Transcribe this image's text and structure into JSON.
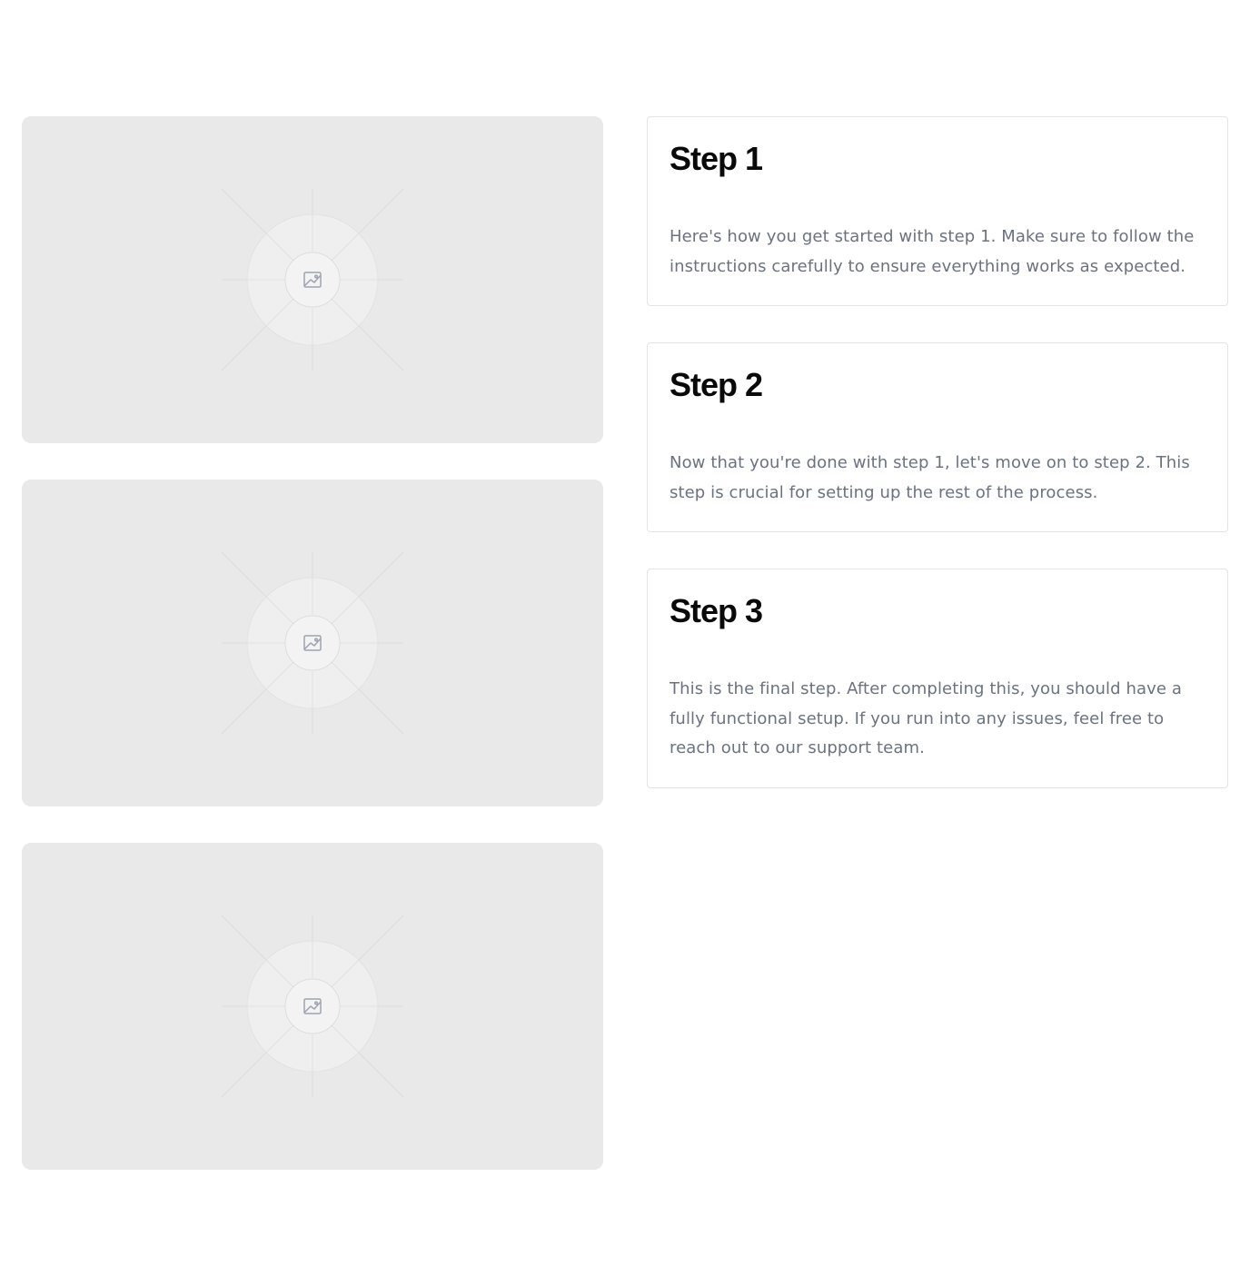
{
  "images": [
    {
      "icon": "image-icon"
    },
    {
      "icon": "image-icon"
    },
    {
      "icon": "image-icon"
    }
  ],
  "steps": [
    {
      "title": "Step 1",
      "description": "Here's how you get started with step 1. Make sure to follow the instructions carefully to ensure everything works as expected."
    },
    {
      "title": "Step 2",
      "description": "Now that you're done with step 1, let's move on to step 2. This step is crucial for setting up the rest of the process."
    },
    {
      "title": "Step 3",
      "description": "This is the final step. After completing this, you should have a fully functional setup. If you run into any issues, feel free to reach out to our support team."
    }
  ],
  "colors": {
    "placeholder_bg": "#e9e9e9",
    "card_border": "#e4e4e7",
    "title": "#0a0a0a",
    "body_text": "#6b7280"
  }
}
